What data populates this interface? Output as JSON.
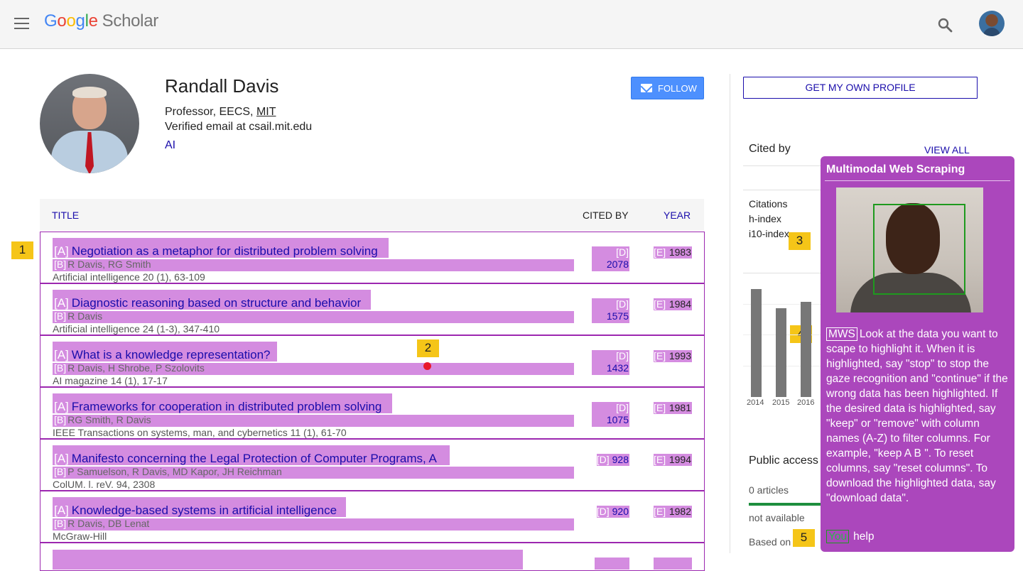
{
  "header": {
    "logo_google": "Google",
    "logo_scholar": "Scholar"
  },
  "profile": {
    "name": "Randall Davis",
    "affiliation_prefix": "Professor, EECS, ",
    "affiliation_org": "MIT",
    "email": "Verified email at csail.mit.edu",
    "interest": "AI",
    "follow_label": "FOLLOW"
  },
  "table": {
    "col_title": "TITLE",
    "col_cited": "CITED BY",
    "col_year": "YEAR",
    "rows": [
      {
        "title": "Negotiation as a metaphor for distributed problem solving",
        "authors": "R Davis, RG Smith",
        "venue": "Artificial intelligence 20 (1), 63-109",
        "cited": "2078",
        "year": "1983"
      },
      {
        "title": "Diagnostic reasoning based on structure and behavior",
        "authors": "R Davis",
        "venue": "Artificial intelligence 24 (1-3), 347-410",
        "cited": "1575",
        "year": "1984"
      },
      {
        "title": "What is a knowledge representation?",
        "authors": "R Davis, H Shrobe, P Szolovits",
        "venue": "AI magazine 14 (1), 17-17",
        "cited": "1432",
        "year": "1993"
      },
      {
        "title": "Frameworks for cooperation in distributed problem solving",
        "authors": "RG Smith, R Davis",
        "venue": "IEEE Transactions on systems, man, and cybernetics 11 (1), 61-70",
        "cited": "1075",
        "year": "1981"
      },
      {
        "title": "Manifesto concerning the Legal Protection of Computer Programs, A",
        "authors": "P Samuelson, R Davis, MD Kapor, JH Reichman",
        "venue": "ColUM. l. reV. 94, 2308",
        "cited": "928",
        "year": "1994"
      },
      {
        "title": "Knowledge-based systems in artificial intelligence",
        "authors": "R Davis, DB Lenat",
        "venue": "McGraw-Hill",
        "cited": "920",
        "year": "1982"
      }
    ],
    "tag_a": "[A]",
    "tag_b": "[B]",
    "tag_d": "[D]",
    "tag_e": "[E]"
  },
  "markers": [
    "1",
    "2",
    "3",
    "4",
    "5"
  ],
  "sidebar": {
    "own_profile": "GET MY OWN PROFILE",
    "cited_by": "Cited by",
    "view_all": "VIEW ALL",
    "stats": [
      "Citations",
      "h-index",
      "i10-index"
    ],
    "chart_years": [
      "2014",
      "2015",
      "2016"
    ],
    "chart_values_relative": [
      1.0,
      0.82,
      0.88
    ],
    "public_access": "Public access",
    "articles": "0 articles",
    "not_available": "not available",
    "based_on": "Based on"
  },
  "mws": {
    "title": "Multimodal Web Scraping",
    "tag": "MWS",
    "instructions": "Look at the data you want to scape to highlight it. When it is highlighted, say \"stop\" to stop the gaze recognition and \"continue\" if the wrong data has been highlighted. If the desired data is highlighted, say \"keep\" or \"remove\" with column names (A-Z) to filter columns. For example, \"keep A B \". To reset columns, say \"reset columns\". To download the highlighted data, say \"download data\".",
    "you": "You",
    "help": "help"
  },
  "colors": {
    "highlight": "#d48ce0",
    "panel": "#ab47bc",
    "link": "#1a0dab",
    "follow": "#4d90fe",
    "marker": "#f5c518"
  }
}
